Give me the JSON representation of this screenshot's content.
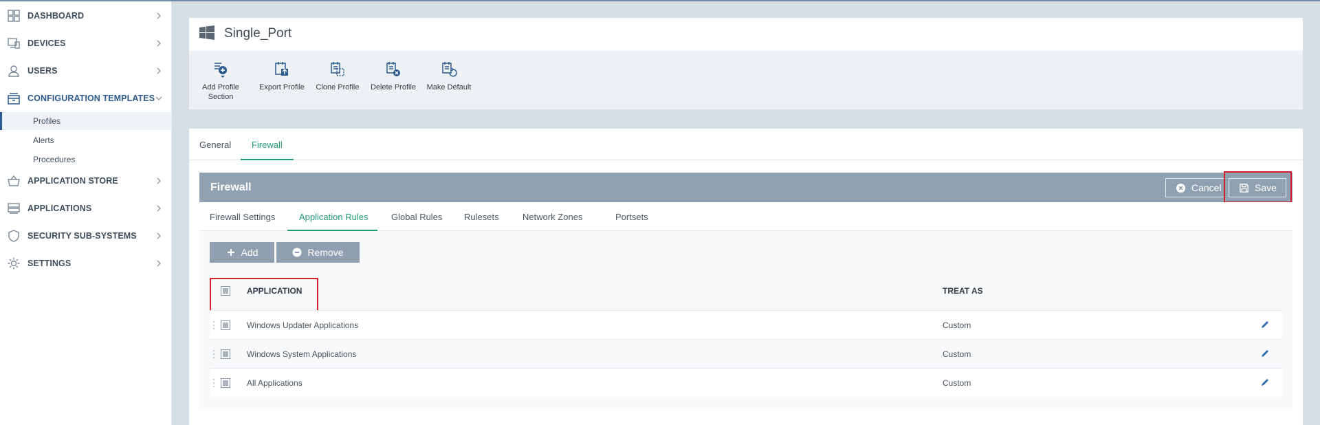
{
  "sidebar": {
    "items": [
      {
        "label": "DASHBOARD",
        "icon": "dashboard-icon"
      },
      {
        "label": "DEVICES",
        "icon": "devices-icon"
      },
      {
        "label": "USERS",
        "icon": "user-icon"
      },
      {
        "label": "CONFIGURATION TEMPLATES",
        "icon": "config-templates-icon",
        "expanded": true
      },
      {
        "label": "APPLICATION STORE",
        "icon": "basket-icon"
      },
      {
        "label": "APPLICATIONS",
        "icon": "applications-icon"
      },
      {
        "label": "SECURITY SUB-SYSTEMS",
        "icon": "shield-icon"
      },
      {
        "label": "SETTINGS",
        "icon": "gear-icon"
      }
    ],
    "subitems": [
      {
        "label": "Profiles",
        "selected": true
      },
      {
        "label": "Alerts"
      },
      {
        "label": "Procedures"
      }
    ]
  },
  "header": {
    "title": "Single_Port",
    "icon": "windows-icon"
  },
  "toolbar": {
    "buttons": [
      {
        "label": "Add Profile Section",
        "line1": "Add Profile",
        "line2": "Section",
        "icon": "add-section-icon"
      },
      {
        "label": "Export Profile",
        "icon": "export-icon"
      },
      {
        "label": "Clone Profile",
        "icon": "clone-icon"
      },
      {
        "label": "Delete Profile",
        "icon": "delete-icon"
      },
      {
        "label": "Make Default",
        "icon": "make-default-icon"
      }
    ]
  },
  "tabs": [
    {
      "label": "General",
      "active": false
    },
    {
      "label": "Firewall",
      "active": true
    }
  ],
  "firewall": {
    "title": "Firewall",
    "cancel_label": "Cancel",
    "save_label": "Save",
    "subtabs": [
      {
        "label": "Firewall Settings",
        "active": false
      },
      {
        "label": "Application Rules",
        "active": true
      },
      {
        "label": "Global Rules",
        "active": false
      },
      {
        "label": "Rulesets",
        "active": false
      },
      {
        "label": "Network Zones",
        "active": false
      },
      {
        "label": "Portsets",
        "active": false
      }
    ],
    "add_label": "Add",
    "remove_label": "Remove",
    "columns": {
      "application": "APPLICATION",
      "treat_as": "TREAT AS"
    },
    "rows": [
      {
        "application": "Windows Updater Applications",
        "treat_as": "Custom"
      },
      {
        "application": "Windows System Applications",
        "treat_as": "Custom"
      },
      {
        "application": "All Applications",
        "treat_as": "Custom"
      }
    ]
  },
  "colors": {
    "accent": "#1f9a76",
    "nav_active": "#2d5a8c",
    "bar": "#90a1b1",
    "highlight": "#d0202e"
  }
}
